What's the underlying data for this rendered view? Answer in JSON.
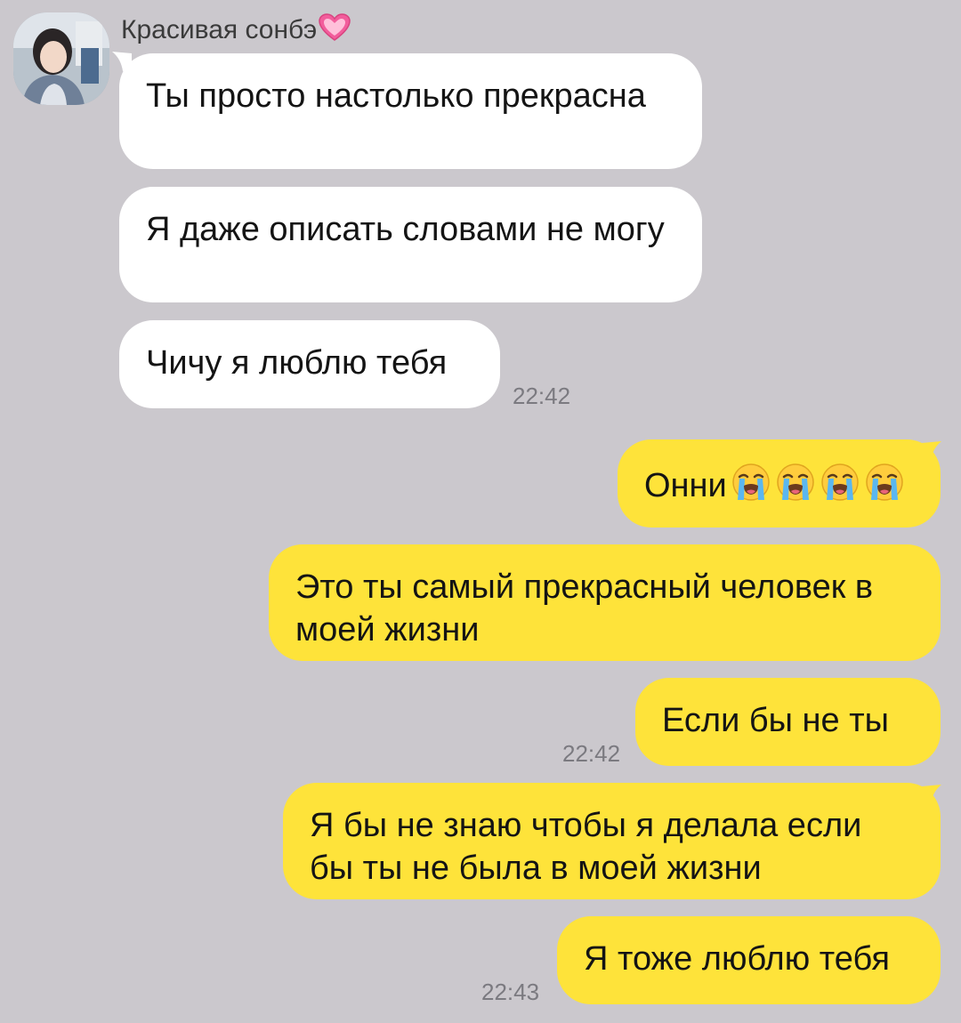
{
  "contact": {
    "name": "Красивая сонбэ",
    "name_emoji_icon": "pink-heart-icon"
  },
  "messages": {
    "incoming": [
      {
        "text": "Ты просто настолько прекрасна"
      },
      {
        "text": "Я даже описать словами не могу"
      },
      {
        "text": "Чичу я люблю тебя"
      }
    ],
    "incoming_time": "22:42",
    "outgoing": [
      {
        "text": "Онни",
        "emoji_icon": "loudly-crying-face-icon",
        "emoji_count": 4
      },
      {
        "text": "Это ты самый прекрасный человек в моей жизни"
      },
      {
        "text": "Если бы не ты"
      },
      {
        "text": "Я бы не знаю чтобы я делала если бы ты не была в моей жизни"
      },
      {
        "text": "Я тоже люблю тебя"
      }
    ],
    "outgoing_time_1": "22:42",
    "outgoing_time_2": "22:43"
  },
  "colors": {
    "background": "#cbc8cd",
    "incoming_bubble": "#ffffff",
    "outgoing_bubble": "#fee33a",
    "timestamp": "#7b7a80"
  }
}
